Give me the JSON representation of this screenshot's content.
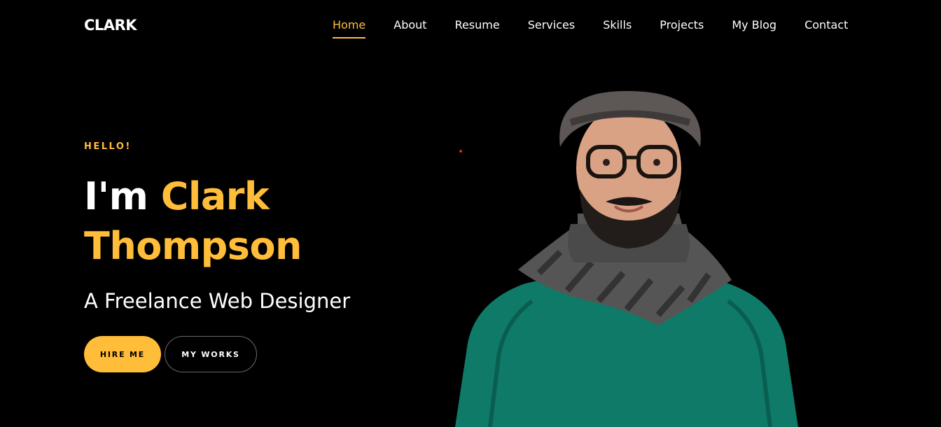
{
  "nav": {
    "logo": "CLARK",
    "items": [
      {
        "label": "Home",
        "active": true
      },
      {
        "label": "About"
      },
      {
        "label": "Resume"
      },
      {
        "label": "Services"
      },
      {
        "label": "Skills"
      },
      {
        "label": "Projects"
      },
      {
        "label": "My Blog"
      },
      {
        "label": "Contact"
      }
    ]
  },
  "hero": {
    "greeting": "HELLO!",
    "headline_prefix": "I'm ",
    "headline_name": "Clark Thompson",
    "subtitle": "A Freelance Web Designer",
    "buttons": {
      "hire": "HIRE ME",
      "works": "MY WORKS"
    }
  },
  "colors": {
    "accent": "#ffbd39",
    "background": "#000000",
    "text": "#ffffff"
  }
}
